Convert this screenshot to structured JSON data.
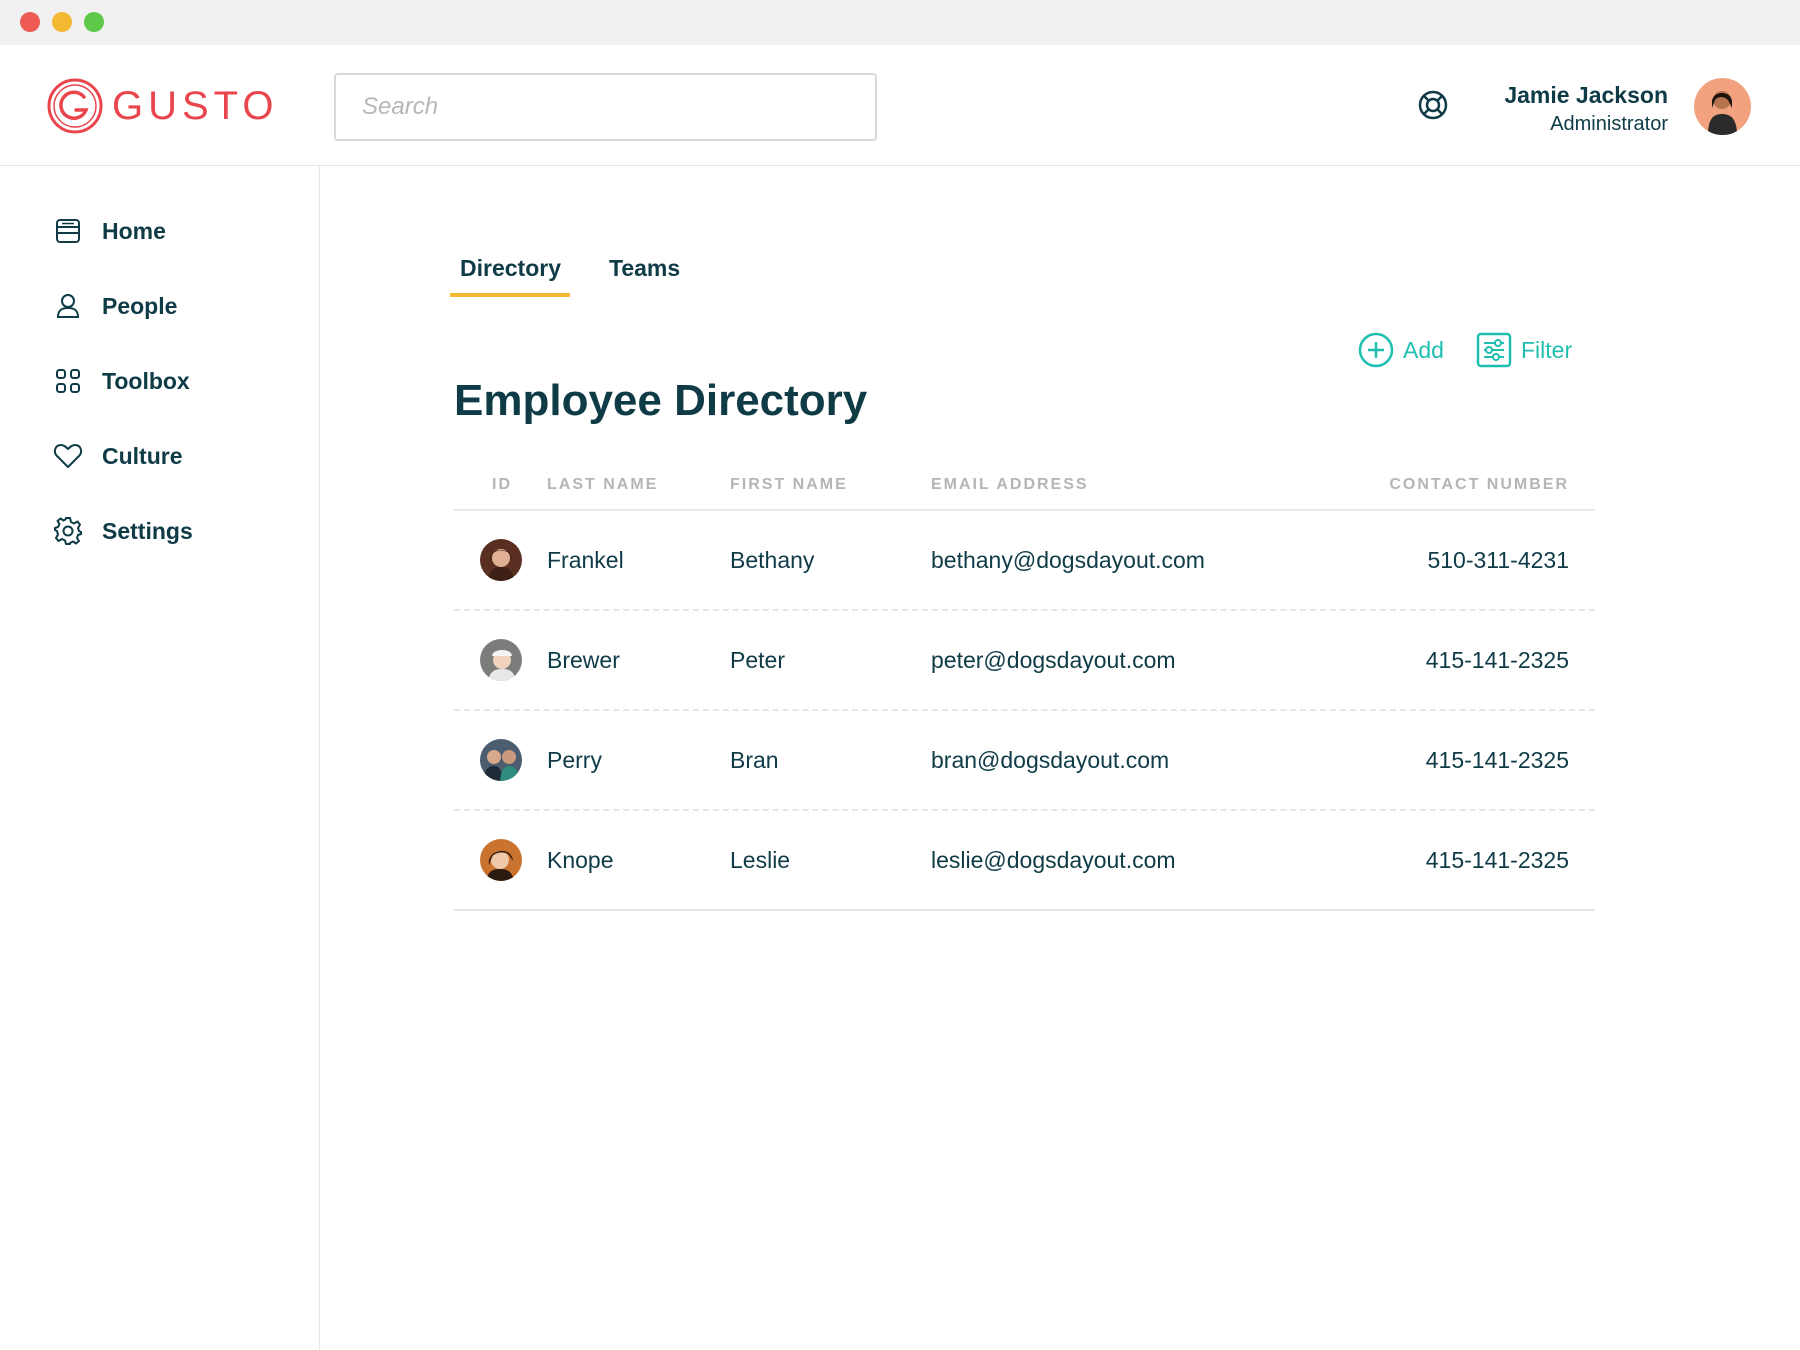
{
  "brand": {
    "name": "GUSTO",
    "color": "#e9454c"
  },
  "search": {
    "placeholder": "Search"
  },
  "user": {
    "name": "Jamie Jackson",
    "role": "Administrator"
  },
  "sidebar": {
    "items": [
      {
        "label": "Home",
        "icon": "home-icon"
      },
      {
        "label": "People",
        "icon": "person-icon"
      },
      {
        "label": "Toolbox",
        "icon": "grid-icon"
      },
      {
        "label": "Culture",
        "icon": "heart-icon"
      },
      {
        "label": "Settings",
        "icon": "gear-icon"
      }
    ]
  },
  "tabs": [
    {
      "label": "Directory",
      "active": true
    },
    {
      "label": "Teams",
      "active": false
    }
  ],
  "actions": {
    "add_label": "Add",
    "filter_label": "Filter",
    "accent": "#1fbfb0"
  },
  "main": {
    "title": "Employee Directory"
  },
  "table": {
    "headers": [
      "ID",
      "LAST NAME",
      "FIRST NAME",
      "EMAIL ADDRESS",
      "CONTACT NUMBER"
    ],
    "rows": [
      {
        "last": "Frankel",
        "first": "Bethany",
        "email": "bethany@dogsdayout.com",
        "phone": "510-311-4231"
      },
      {
        "last": "Brewer",
        "first": "Peter",
        "email": "peter@dogsdayout.com",
        "phone": "415-141-2325"
      },
      {
        "last": "Perry",
        "first": "Bran",
        "email": "bran@dogsdayout.com",
        "phone": "415-141-2325"
      },
      {
        "last": "Knope",
        "first": "Leslie",
        "email": "leslie@dogsdayout.com",
        "phone": "415-141-2325"
      }
    ]
  },
  "colors": {
    "text": "#0f3b47",
    "tab_underline": "#f4b835",
    "header_text": "#b5b5b5"
  }
}
